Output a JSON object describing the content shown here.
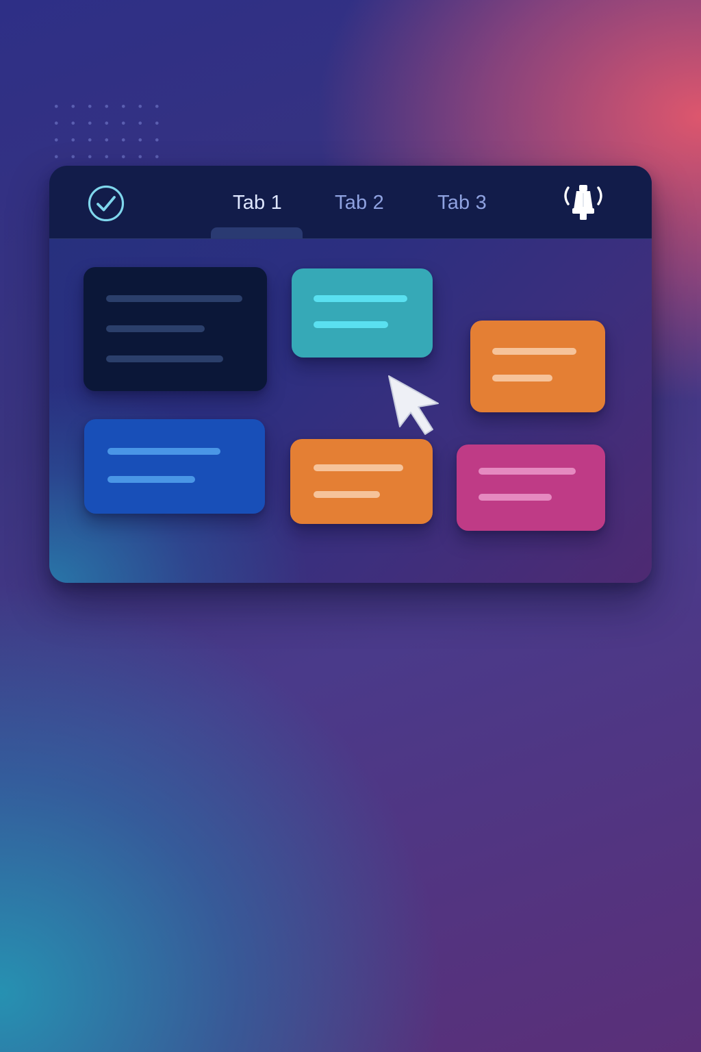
{
  "tabs": [
    {
      "label": "Tab 1",
      "active": true
    },
    {
      "label": "Tab 2",
      "active": false
    },
    {
      "label": "Tab 3",
      "active": false
    }
  ],
  "icons": {
    "left": "check-circle-icon",
    "right": "notification-bell-icon",
    "pointer": "mouse-cursor-icon"
  },
  "colors": {
    "navbar": "#121c4a",
    "tab_active": "#dfe7ff",
    "tab_inactive": "#8fa2e0",
    "check_icon": "#7fd6ec",
    "card_dark": "#0b1738",
    "card_teal": "#36a9b7",
    "card_orange": "#e47f34",
    "card_blue": "#184fb8",
    "card_pink": "#bf3b86"
  },
  "cards": [
    {
      "name": "dark",
      "color": "#0b1738",
      "placeholder_lines": 3
    },
    {
      "name": "teal",
      "color": "#36a9b7",
      "placeholder_lines": 2
    },
    {
      "name": "orange",
      "color": "#e47f34",
      "placeholder_lines": 2
    },
    {
      "name": "blue",
      "color": "#184fb8",
      "placeholder_lines": 2
    },
    {
      "name": "orange",
      "color": "#e47f34",
      "placeholder_lines": 2
    },
    {
      "name": "pink",
      "color": "#bf3b86",
      "placeholder_lines": 2
    }
  ]
}
